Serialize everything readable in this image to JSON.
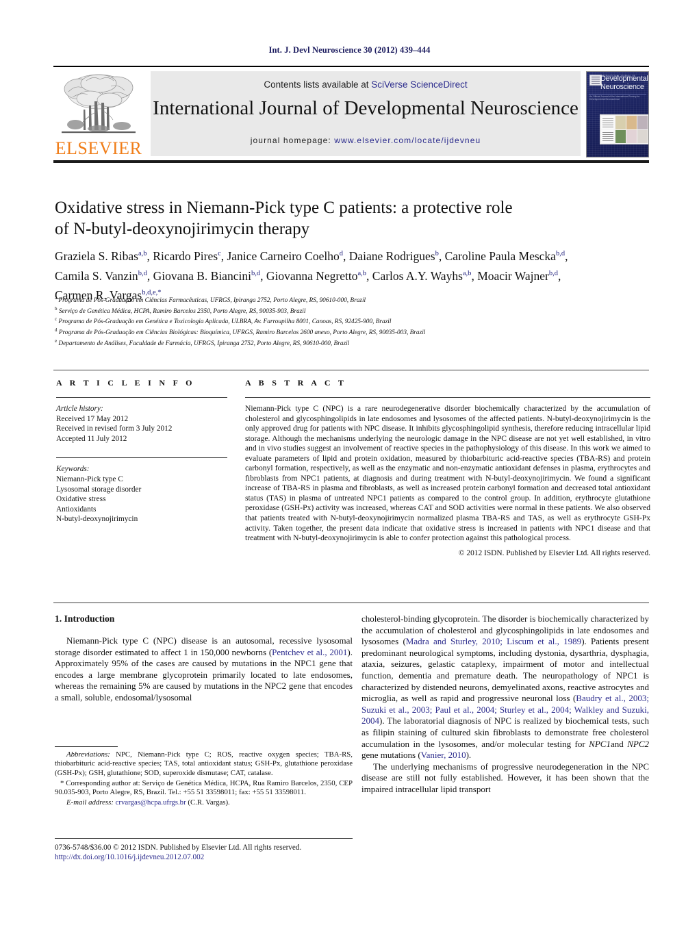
{
  "running_head": "Int. J. Devl Neuroscience 30 (2012) 439–444",
  "masthead": {
    "contents_prefix": "Contents lists available at ",
    "contents_link": "SciVerse ScienceDirect",
    "journal_name": "International Journal of Developmental Neuroscience",
    "homepage_prefix": "journal homepage: ",
    "homepage_url": "www.elsevier.com/locate/ijdevneu",
    "publisher_wordmark": "ELSEVIER",
    "publisher_color": "#f07d18",
    "cover": {
      "line1": "Developmental",
      "line2": "Neuroscience",
      "top_micro": "INTERNATIONAL JOURNAL OF",
      "tag_micro": "An Official Journal of the International Society for Developmental Neuroscience",
      "background_color": "#1a2260"
    }
  },
  "article": {
    "title_line1": "Oxidative stress in Niemann-Pick type C patients: a protective role",
    "title_line2": "of N-butyl-deoxynojirimycin therapy",
    "authors": [
      {
        "name": "Graziela S. Ribas",
        "sup": "a,b"
      },
      {
        "name": "Ricardo Pires",
        "sup": "c"
      },
      {
        "name": "Janice Carneiro Coelho",
        "sup": "d"
      },
      {
        "name": "Daiane Rodrigues",
        "sup": "b"
      },
      {
        "name": "Caroline Paula Mescka",
        "sup": "b,d"
      },
      {
        "name": "Camila S. Vanzin",
        "sup": "b,d"
      },
      {
        "name": "Giovana B. Biancini",
        "sup": "b,d"
      },
      {
        "name": "Giovanna Negretto",
        "sup": "a,b"
      },
      {
        "name": "Carlos A.Y. Wayhs",
        "sup": "a,b"
      },
      {
        "name": "Moacir Wajner",
        "sup": "b,d"
      },
      {
        "name": "Carmen R. Vargas",
        "sup": "b,d,e,*"
      }
    ],
    "affiliations": [
      {
        "mark": "a",
        "text": "Programa de Pós-Graduação em Ciências Farmacêuticas, UFRGS, Ipiranga 2752, Porto Alegre, RS, 90610-000, Brazil"
      },
      {
        "mark": "b",
        "text": "Serviço de Genética Médica, HCPA, Ramiro Barcelos 2350, Porto Alegre, RS, 90035-903, Brazil"
      },
      {
        "mark": "c",
        "text": "Programa de Pós-Graduação em Genética e Toxicologia Aplicada, ULBRA, Av. Farroupilha 8001, Canoas, RS, 92425-900, Brazil"
      },
      {
        "mark": "d",
        "text": "Programa de Pós-Graduação em Ciências Biológicas: Bioquímica, UFRGS, Ramiro Barcelos 2600 anexo, Porto Alegre, RS, 90035-003, Brazil"
      },
      {
        "mark": "e",
        "text": "Departamento de Análises, Faculdade de Farmácia, UFRGS, Ipiranga 2752, Porto Alegre, RS, 90610-000, Brazil"
      }
    ]
  },
  "article_info": {
    "heading": "A R T I C L E   I N F O",
    "history_label": "Article history:",
    "history": [
      "Received 17 May 2012",
      "Received in revised form 3 July 2012",
      "Accepted 11 July 2012"
    ],
    "keywords_label": "Keywords:",
    "keywords": [
      "Niemann-Pick type C",
      "Lysosomal storage disorder",
      "Oxidative stress",
      "Antioxidants",
      "N-butyl-deoxynojirimycin"
    ]
  },
  "abstract": {
    "heading": "A B S T R A C T",
    "text": "Niemann-Pick type C (NPC) is a rare neurodegenerative disorder biochemically characterized by the accumulation of cholesterol and glycosphingolipids in late endosomes and lysosomes of the affected patients. N-butyl-deoxynojirimycin is the only approved drug for patients with NPC disease. It inhibits glycosphingolipid synthesis, therefore reducing intracellular lipid storage. Although the mechanisms underlying the neurologic damage in the NPC disease are not yet well established, in vitro and in vivo studies suggest an involvement of reactive species in the pathophysiology of this disease. In this work we aimed to evaluate parameters of lipid and protein oxidation, measured by thiobarbituric acid-reactive species (TBA-RS) and protein carbonyl formation, respectively, as well as the enzymatic and non-enzymatic antioxidant defenses in plasma, erythrocytes and fibroblasts from NPC1 patients, at diagnosis and during treatment with N-butyl-deoxynojirimycin. We found a significant increase of TBA-RS in plasma and fibroblasts, as well as increased protein carbonyl formation and decreased total antioxidant status (TAS) in plasma of untreated NPC1 patients as compared to the control group. In addition, erythrocyte glutathione peroxidase (GSH-Px) activity was increased, whereas CAT and SOD activities were normal in these patients. We also observed that patients treated with N-butyl-deoxynojirimycin normalized plasma TBA-RS and TAS, as well as erythrocyte GSH-Px activity. Taken together, the present data indicate that oxidative stress is increased in patients with NPC1 disease and that treatment with N-butyl-deoxynojirimycin is able to confer protection against this pathological process.",
    "copyright": "© 2012 ISDN. Published by Elsevier Ltd. All rights reserved."
  },
  "body": {
    "section_heading": "1.  Introduction",
    "left_paragraph_1_a": "Niemann-Pick type C (NPC) disease is an autosomal, recessive lysosomal storage disorder estimated to affect 1 in 150,000 newborns (",
    "left_ref_1": "Pentchev et al., 2001",
    "left_paragraph_1_b": "). Approximately 95% of the cases are caused by mutations in the NPC1 gene that encodes a large membrane glycoprotein primarily located to late endosomes, whereas the remaining 5% are caused by mutations in the NPC2 gene that encodes a small, soluble, endosomal/lysosomal",
    "right_p1_a": "cholesterol-binding glycoprotein. The disorder is biochemically characterized by the accumulation of cholesterol and glycosphingolipids in late endosomes and lysosomes (",
    "right_ref_1": "Madra and Sturley, 2010; Liscum et al., 1989",
    "right_p1_b": "). Patients present predominant neurological symptoms, including dystonia, dysarthria, dysphagia, ataxia, seizures, gelastic cataplexy, impairment of motor and intellectual function, dementia and premature death. The neuropathology of NPC1 is characterized by distended neurons, demyelinated axons, reactive astrocytes and microglia, as well as rapid and progressive neuronal loss (",
    "right_ref_2": "Baudry et al., 2003; Suzuki et al., 2003; Paul et al., 2004; Sturley et al., 2004; Walkley and Suzuki, 2004",
    "right_p1_c": "). The laboratorial diagnosis of NPC is realized by biochemical tests, such as filipin staining of cultured skin fibroblasts to demonstrate free cholesterol accumulation in the lysosomes, and/or molecular testing for ",
    "right_p1_italic": "NPC1",
    "right_p1_d": "and ",
    "right_p1_italic2": "NPC2",
    "right_p1_e": " gene mutations (",
    "right_ref_3": "Vanier, 2010",
    "right_p1_f": ").",
    "right_p2": "The underlying mechanisms of progressive neurodegeneration in the NPC disease are still not fully established. However, it has been shown that the impaired intracellular lipid transport"
  },
  "footnotes": {
    "abbrev_label": "Abbreviations:",
    "abbrev_text": " NPC, Niemann-Pick type C; ROS, reactive oxygen species; TBA-RS, thiobarbituric acid-reactive species; TAS, total antioxidant status; GSH-Px, glutathione peroxidase (GSH-Px); GSH, glutathione; SOD, superoxide dismutase; CAT, catalase.",
    "corresponding": "* Corresponding author at: Serviço de Genética Médica, HCPA, Rua Ramiro Barcelos, 2350, CEP 90.035-903, Porto Alegre, RS, Brazil. Tel.: +55 51 33598011; fax: +55 51 33598011.",
    "email_label": "E-mail address:",
    "email": "crvargas@hcpa.ufrgs.br",
    "email_suffix": " (C.R. Vargas)."
  },
  "footer": {
    "issn_line": "0736-5748/$36.00 © 2012 ISDN. Published by Elsevier Ltd. All rights reserved.",
    "doi": "http://dx.doi.org/10.1016/j.ijdevneu.2012.07.002"
  }
}
